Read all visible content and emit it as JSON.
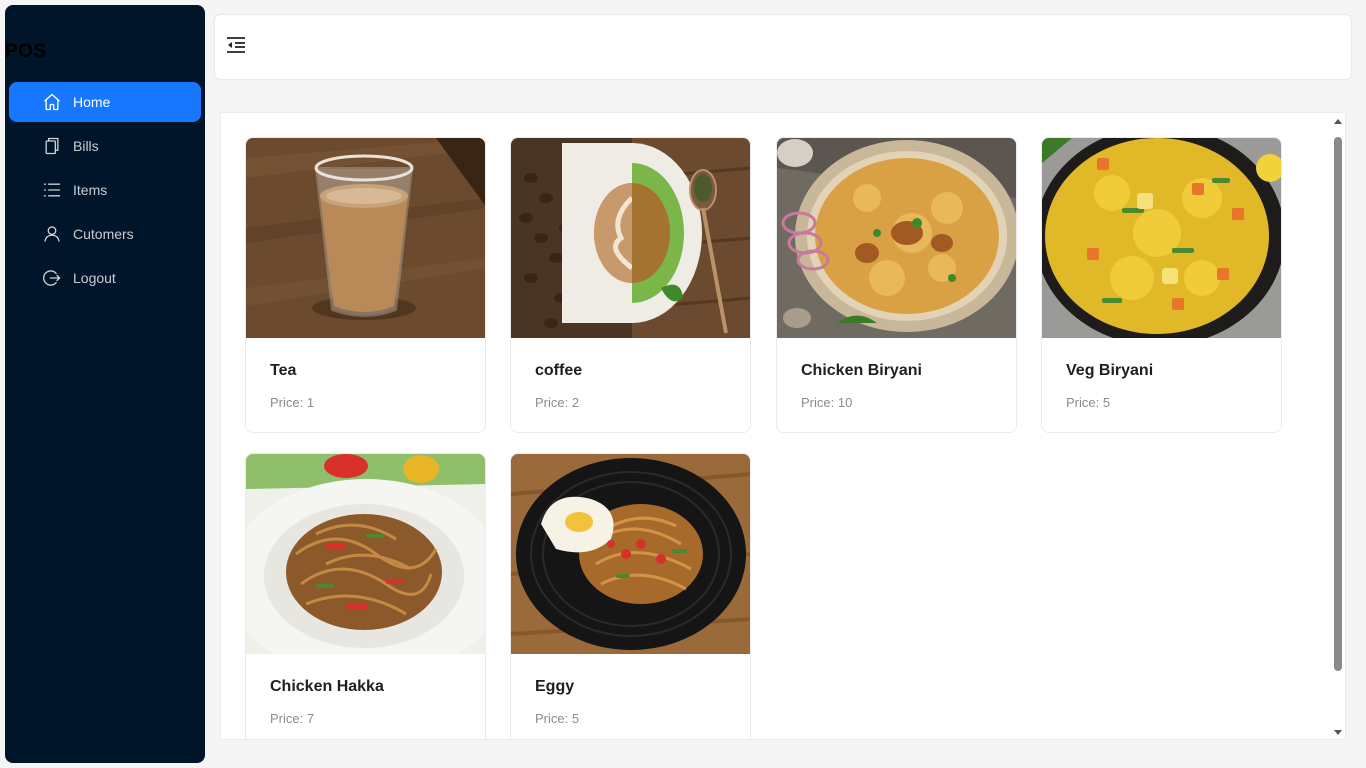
{
  "app": {
    "logo": "POS"
  },
  "sidebar": {
    "items": [
      {
        "label": "Home",
        "icon": "home-icon",
        "active": true
      },
      {
        "label": "Bills",
        "icon": "bills-icon",
        "active": false
      },
      {
        "label": "Items",
        "icon": "list-icon",
        "active": false
      },
      {
        "label": "Cutomers",
        "icon": "user-icon",
        "active": false
      },
      {
        "label": "Logout",
        "icon": "logout-icon",
        "active": false
      }
    ]
  },
  "header": {
    "toggle_icon": "menu-fold-icon"
  },
  "products": [
    {
      "name": "Tea",
      "price": "Price: 1"
    },
    {
      "name": "coffee",
      "price": "Price: 2"
    },
    {
      "name": "Chicken Biryani",
      "price": "Price: 10"
    },
    {
      "name": "Veg Biryani",
      "price": "Price: 5"
    },
    {
      "name": "Chicken Hakka",
      "price": "Price: 7"
    },
    {
      "name": "Eggy",
      "price": "Price: 5"
    }
  ],
  "colors": {
    "sidebar_bg": "#001529",
    "accent": "#1677ff",
    "page_bg": "#f5f5f5"
  }
}
